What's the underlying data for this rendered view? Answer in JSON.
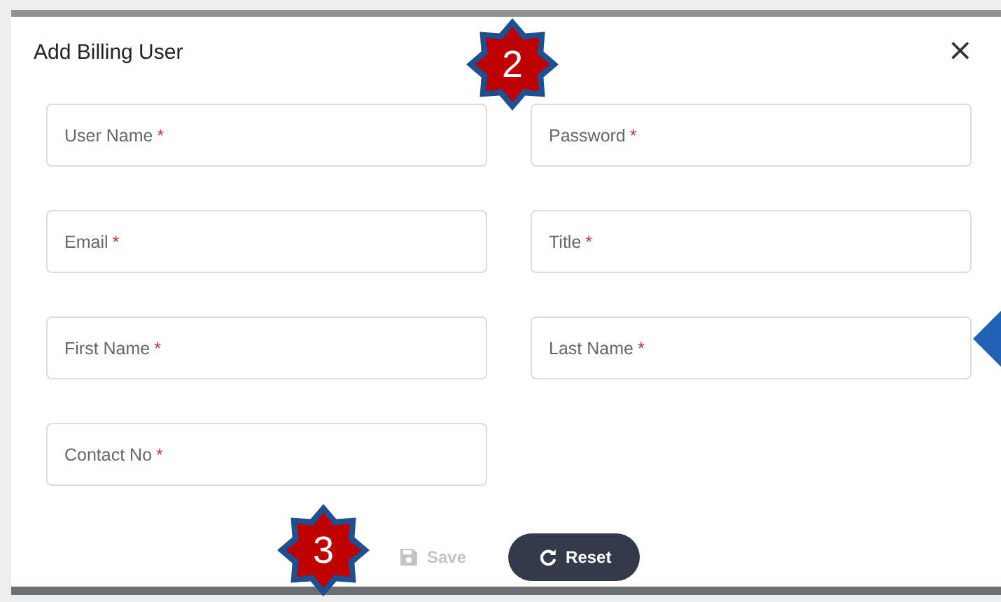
{
  "dialog": {
    "title": "Add Billing User",
    "close_glyph": "×"
  },
  "fields": [
    {
      "label": "User Name",
      "required_mark": "*"
    },
    {
      "label": "Password",
      "required_mark": "*"
    },
    {
      "label": "Email",
      "required_mark": "*"
    },
    {
      "label": "Title",
      "required_mark": "*"
    },
    {
      "label": "First Name",
      "required_mark": "*"
    },
    {
      "label": "Last Name",
      "required_mark": "*"
    },
    {
      "label": "Contact No",
      "required_mark": "*"
    }
  ],
  "buttons": [
    {
      "label": "Save",
      "kind": "save",
      "disabled": true
    },
    {
      "label": "Reset",
      "kind": "reset",
      "disabled": false
    }
  ],
  "annotations": [
    {
      "number": "2"
    },
    {
      "number": "3"
    }
  ]
}
